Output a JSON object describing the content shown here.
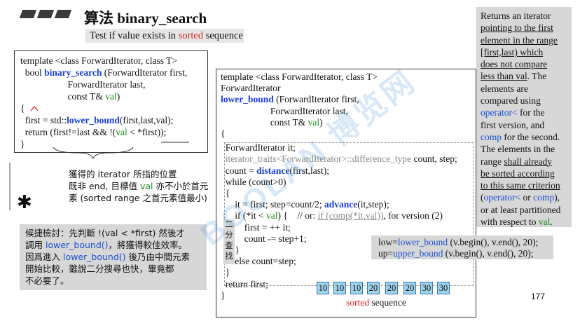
{
  "header": {
    "title_zh": "算法",
    "title_en": "binary_search",
    "subtitle_pre": "Test if value exists in ",
    "subtitle_em": "sorted",
    "subtitle_post": " sequence"
  },
  "code1": {
    "l1": "template <class ForwardIterator, class T>",
    "l2_pre": "  bool ",
    "l2_fn": "binary_search",
    "l2_post": " (ForwardIterator first,",
    "l3": "                    ForwardIterator last,",
    "l4_pre": "                    const T& ",
    "l4_val": "val",
    "l4_post": ")",
    "l5": "{",
    "l6_pre": "  first = std::",
    "l6_fn": "lower_bound",
    "l6_post": "(first,last,val);",
    "l7_pre": "  return (first!=last && !(",
    "l7_val": "val",
    "l7_post": " < *first));",
    "l8": "}"
  },
  "note1": {
    "l1": "獲得的 iterator 所指的位置",
    "l2_pre": "既非 end, 目標值 ",
    "l2_val": "val",
    "l2_post": " 亦不小於首元",
    "l3": "素 (sorted range 之首元素值最小)"
  },
  "note2": {
    "l1": "候捷檢討：先判斷 !(val < *first) 然後才",
    "l2_pre": "調用 ",
    "l2_fn": "lower_bound()",
    "l2_post": "，將獲得較佳效率。",
    "l3_pre": "因爲進入 ",
    "l3_fn": "lower_bound()",
    "l3_post": " 後乃由中間元素",
    "l4": "開始比較，雖說二分搜尋也快，畢竟都",
    "l5": "不必要了。"
  },
  "code2": {
    "l1": "template <class ForwardIterator, class T>",
    "l2": "ForwardIterator",
    "l3_fn": "lower_bound",
    "l3_post": " (ForwardIterator first,",
    "l4": "                     ForwardIterator last,",
    "l5_pre": "                     const T& ",
    "l5_val": "val",
    "l5_post": ")",
    "l6": "{",
    "l7": "  ForwardIterator it;",
    "l8_gray": "  iterator_traits<ForwardIterator>::difference_type",
    "l8_post": " count, step;",
    "l9_pre": "  count = ",
    "l9_fn": "distance",
    "l9_post": "(first,last);",
    "l10": "  while (count>0)",
    "l11": "  {",
    "l12_pre": "      it = first; step=count/2; ",
    "l12_fn": "advance",
    "l12_post": "(it,step);",
    "l13_pre": "      if (*it < ",
    "l13_val": "val",
    "l13_mid": ") {    // or: ",
    "l13_gray": "if (comp(*it,val))",
    "l13_post": ", for version (2)",
    "l14": "          first = ++ it;",
    "l15": "          count -= step+1;",
    "l16": "      }",
    "l17": "      else count=step;",
    "l18": "  }",
    "l19": "  return first;",
    "l20": "}"
  },
  "bsearch_label": [
    "二",
    "分",
    "查",
    "找"
  ],
  "calls": {
    "l1_pre": "low=",
    "l1_fn": "lower_bound",
    "l1_post": " (v.begin(), v.end(), 20);",
    "l2_pre": "up=",
    "l2_fn": "upper_bound",
    "l2_post": " (v.begin(), v.end(), 20);"
  },
  "array": [
    "10",
    "10",
    "10",
    "20",
    "20",
    "20",
    "30",
    "30"
  ],
  "sorted_label": {
    "em": "sorted",
    "post": " sequence"
  },
  "desc": {
    "l1": "Returns an iterator",
    "l2": "pointing to the first",
    "l3": "element in the range",
    "l4": "[first,last) which",
    "l5": "does not compare",
    "l6_pre": "less than ",
    "l6_val": "val",
    "l6_post": ". The",
    "l7": "elements are",
    "l8": "compared using",
    "l9_fn": "operator<",
    "l9_post": " for the",
    "l10": "first version, and",
    "l11_fn": "comp",
    "l11_post": " for the second.",
    "l12": "The elements in the",
    "l13_pre": "range ",
    "l13_ul": "shall already",
    "l14": "be sorted according",
    "l15": "to this same criterion",
    "l16_pre": "(",
    "l16_fn1": "operator<",
    "l16_mid": " or ",
    "l16_fn2": "comp",
    "l16_post": "),",
    "l17": "or at least partitioned",
    "l18_pre": "with respect to ",
    "l18_val": "val",
    "l18_post": "."
  },
  "page_number": "177",
  "watermark": "BOOLAN 博览网"
}
